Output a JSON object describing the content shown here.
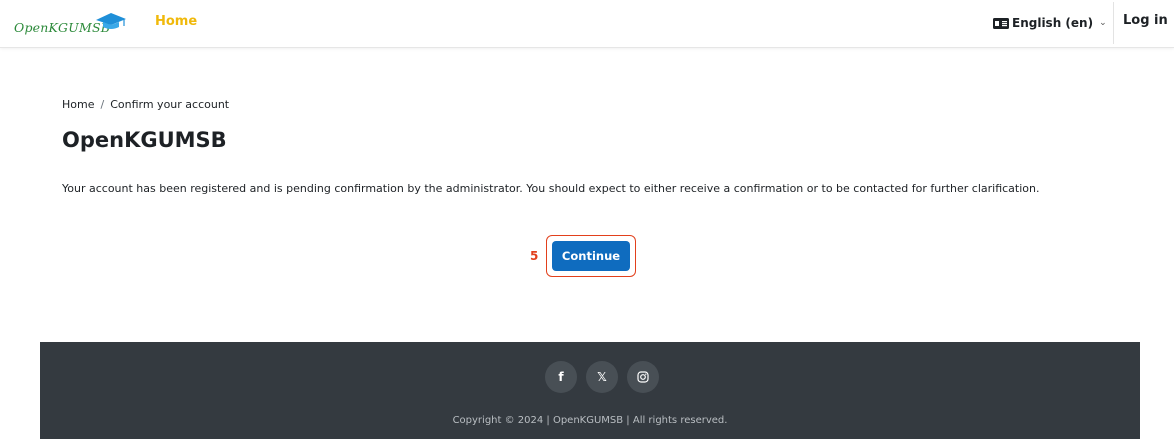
{
  "header": {
    "logo_text": "OpenKGUMSB",
    "nav_home": "Home",
    "language": "English (en)",
    "language_caret": "⌄",
    "login": "Log in"
  },
  "breadcrumb": {
    "home": "Home",
    "separator": "/",
    "current": "Confirm your account"
  },
  "page": {
    "title": "OpenKGUMSB",
    "message": "Your account has been registered and is pending confirmation by the administrator. You should expect to either receive a confirmation or to be contacted for further clarification."
  },
  "action": {
    "step_number": "5",
    "continue_label": "Continue"
  },
  "footer": {
    "social": [
      {
        "icon": "facebook-icon",
        "glyph": "f"
      },
      {
        "icon": "x-twitter-icon",
        "glyph": "𝕏"
      },
      {
        "icon": "instagram-icon",
        "glyph": ""
      }
    ],
    "copyright": "Copyright © 2024 | OpenKGUMSB | All rights reserved."
  },
  "colors": {
    "brand_yellow": "#f0b90b",
    "primary_button": "#0f6cbf",
    "annotation_red": "#e2401c",
    "footer_bg": "#343a40"
  }
}
